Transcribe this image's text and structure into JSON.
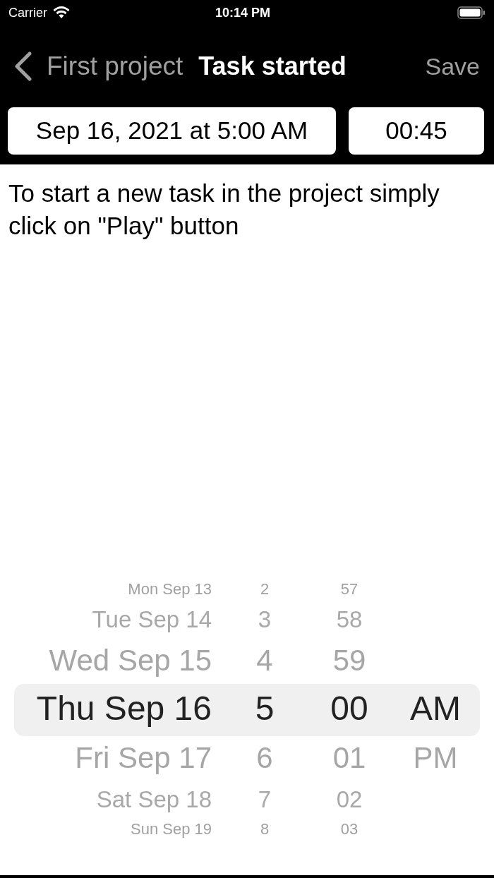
{
  "status_bar": {
    "carrier": "Carrier",
    "time": "10:14 PM"
  },
  "nav": {
    "back_label": "First project",
    "title": "Task started",
    "save": {
      "label": "Save",
      "disabled": true
    }
  },
  "fields": {
    "start": "Sep 16, 2021 at 5:00 AM",
    "duration": "00:45"
  },
  "message": "To start a new task in the project simply click on \"Play\" button",
  "picker": {
    "rows": [
      {
        "date": "Mon Sep 13",
        "hour": "2",
        "minute": "57",
        "selected": false
      },
      {
        "date": "Tue Sep 14",
        "hour": "3",
        "minute": "58",
        "selected": false
      },
      {
        "date": "Wed Sep 15",
        "hour": "4",
        "minute": "59",
        "selected": false
      },
      {
        "date": "Thu Sep 16",
        "hour": "5",
        "minute": "00",
        "period": "AM",
        "selected": true
      },
      {
        "date": "Fri Sep 17",
        "hour": "6",
        "minute": "01",
        "period": "PM",
        "selected": false
      },
      {
        "date": "Sat Sep 18",
        "hour": "7",
        "minute": "02",
        "selected": false
      },
      {
        "date": "Sun Sep 19",
        "hour": "8",
        "minute": "03",
        "selected": false
      }
    ]
  }
}
